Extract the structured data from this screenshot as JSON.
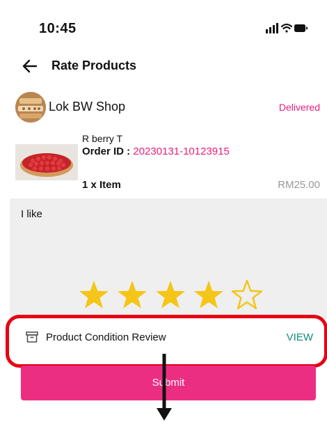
{
  "status_bar": {
    "time": "10:45"
  },
  "header": {
    "title": "Rate Products"
  },
  "shop": {
    "name": "Lok BW Shop",
    "status": "Delivered"
  },
  "product": {
    "name": "R berry T",
    "order_id_label": "Order ID : ",
    "order_id": "20230131-10123915",
    "quantity": "1 x Item",
    "price": "RM25.00"
  },
  "review": {
    "text": "I like",
    "rating": 4,
    "max_rating": 5
  },
  "condition_review": {
    "label": "Product Condition Review",
    "action": "VIEW"
  },
  "submit_label": "Submit",
  "colors": {
    "accent": "#ec2e83",
    "status": "#e91e7a",
    "view": "#0f8f7a",
    "star": "#f5c518",
    "highlight": "#e60012"
  }
}
